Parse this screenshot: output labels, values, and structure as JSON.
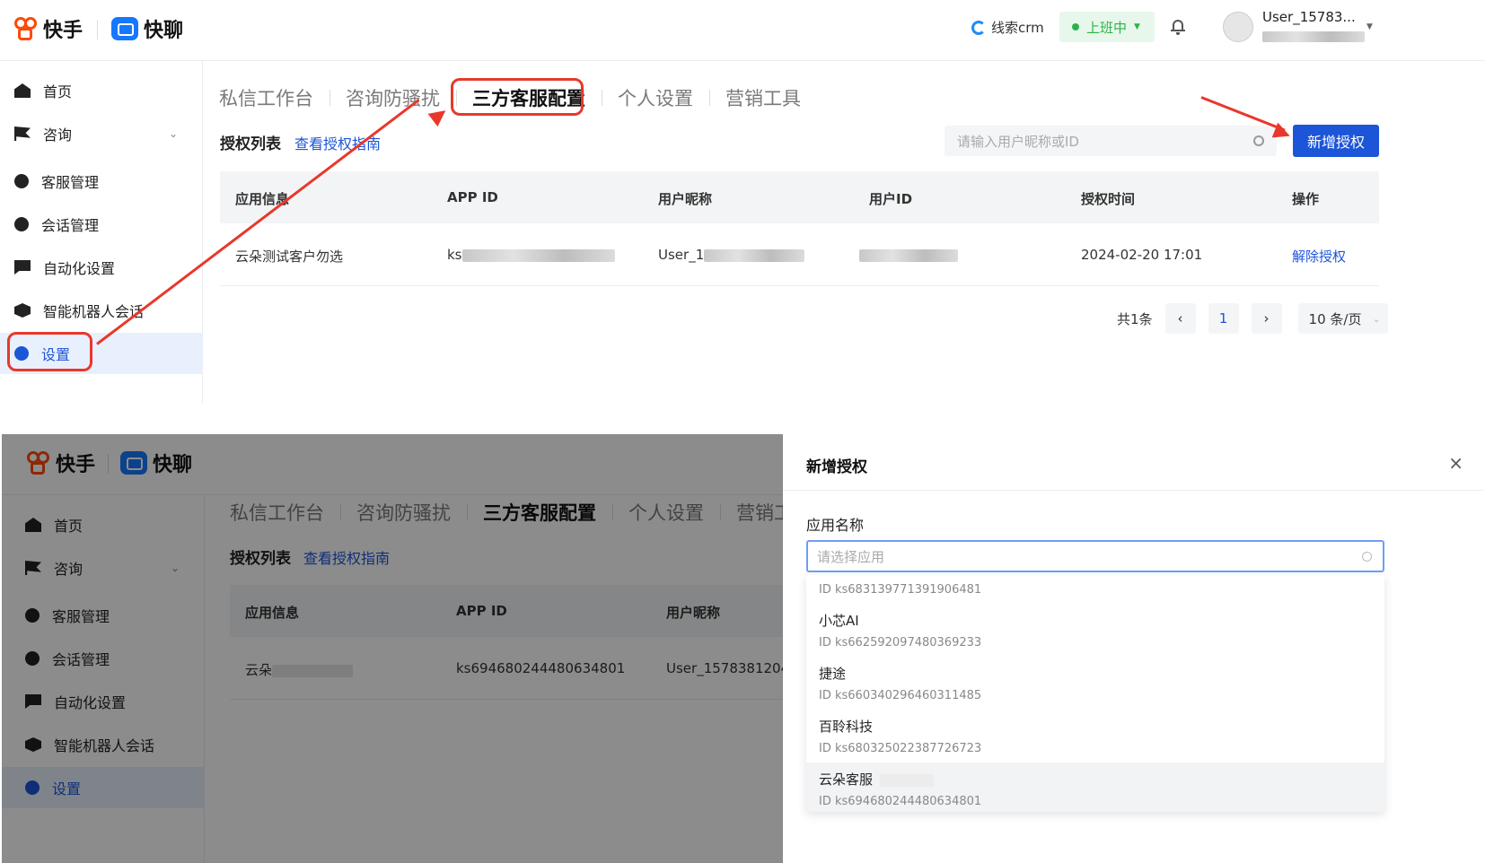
{
  "brand": {
    "kuaishou": "快手",
    "kuailiao": "快聊"
  },
  "header": {
    "crm_label": "线索crm",
    "status_label": "上班中",
    "user_name": "User_15783...",
    "colors": {
      "accent": "#1d55d8",
      "status_green": "#2bb34a",
      "annotation_red": "#e8382b"
    }
  },
  "sidebar": {
    "items": [
      {
        "label": "首页",
        "icon": "home-icon"
      },
      {
        "label": "咨询",
        "icon": "flag-icon"
      },
      {
        "label": "客服管理",
        "icon": "user-icon"
      },
      {
        "label": "会话管理",
        "icon": "user-voice-icon"
      },
      {
        "label": "自动化设置",
        "icon": "chat-icon"
      },
      {
        "label": "智能机器人会话",
        "icon": "robot-icon"
      },
      {
        "label": "设置",
        "icon": "settings-icon"
      }
    ]
  },
  "tabs": [
    "私信工作台",
    "咨询防骚扰",
    "三方客服配置",
    "个人设置",
    "营销工具"
  ],
  "auth": {
    "title": "授权列表",
    "guide_link": "查看授权指南",
    "search_placeholder": "请输入用户昵称或ID",
    "add_button": "新增授权",
    "columns": [
      "应用信息",
      "APP ID",
      "用户昵称",
      "用户ID",
      "授权时间",
      "操作"
    ],
    "row": {
      "app_info": "云朵测试客户勿选",
      "app_id_prefix": "ks",
      "nickname_prefix": "User_1",
      "auth_time": "2024-02-20 17:01",
      "action": "解除授权"
    },
    "bottom_row": {
      "app_info": "云朵",
      "app_id": "ks694680244480634801",
      "nickname": "User_1578381204"
    },
    "pagination": {
      "total": "共1条",
      "prev": "‹",
      "current": "1",
      "next": "›",
      "page_size": "10 条/页"
    }
  },
  "drawer": {
    "title": "新增授权",
    "close": "×",
    "field_label": "应用名称",
    "placeholder": "请选择应用",
    "options": [
      {
        "name": "",
        "id": "ID ks683139771391906481"
      },
      {
        "name": "小芯AI",
        "id": "ID ks662592097480369233"
      },
      {
        "name": "捷途",
        "id": "ID ks660340296460311485"
      },
      {
        "name": "百聆科技",
        "id": "ID ks680325022387726723"
      },
      {
        "name": "云朵客服",
        "id": "ID ks694680244480634801"
      }
    ]
  }
}
